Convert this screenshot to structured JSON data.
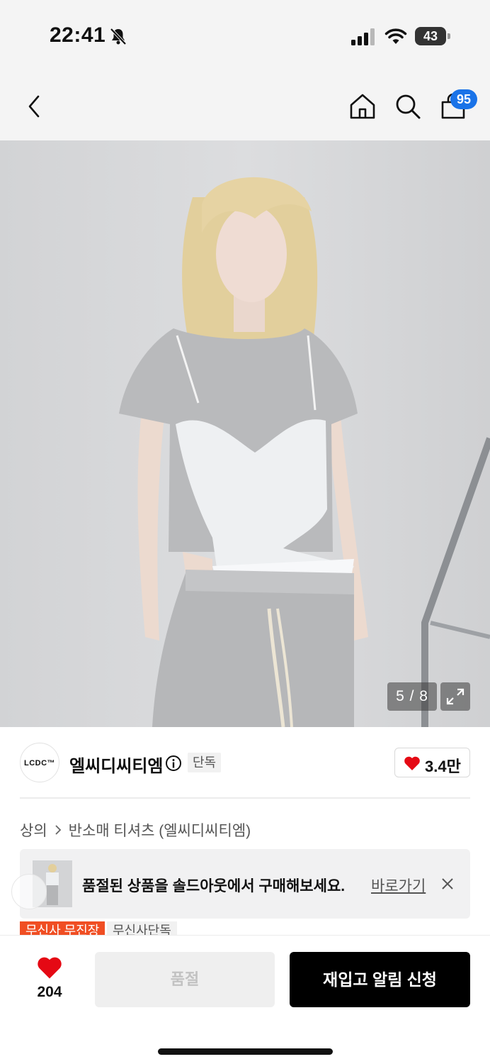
{
  "status_bar": {
    "time": "22:41",
    "battery": "43",
    "icons": [
      "bell-slash-icon",
      "signal-icon",
      "wifi-icon",
      "battery-icon"
    ]
  },
  "header": {
    "icons": [
      "back-icon",
      "home-icon",
      "search-icon",
      "cart-icon"
    ],
    "cart_count": "95"
  },
  "gallery": {
    "pager": "5 / 8",
    "expand_icon": "expand-icon"
  },
  "brand": {
    "logo_text": "LCDC™",
    "name": "엘씨디씨티엠",
    "tag": "단독",
    "likes": "3.4만"
  },
  "breadcrumb": {
    "category": "상의",
    "subcategory": "반소매 티셔츠 (엘씨디씨티엠)"
  },
  "soldout_banner": {
    "message": "품절된 상품을 솔드아웃에서 구매해보세요.",
    "link": "바로가기"
  },
  "tags": {
    "primary": "무신사 무진장",
    "secondary": "무신사단독"
  },
  "bottom_bar": {
    "wish_count": "204",
    "soldout_label": "품절",
    "restock_label": "재입고 알림 신청"
  },
  "colors": {
    "accent_blue": "#1a73e8",
    "heart_red": "#e50914",
    "tag_orange": "#f04e23"
  }
}
